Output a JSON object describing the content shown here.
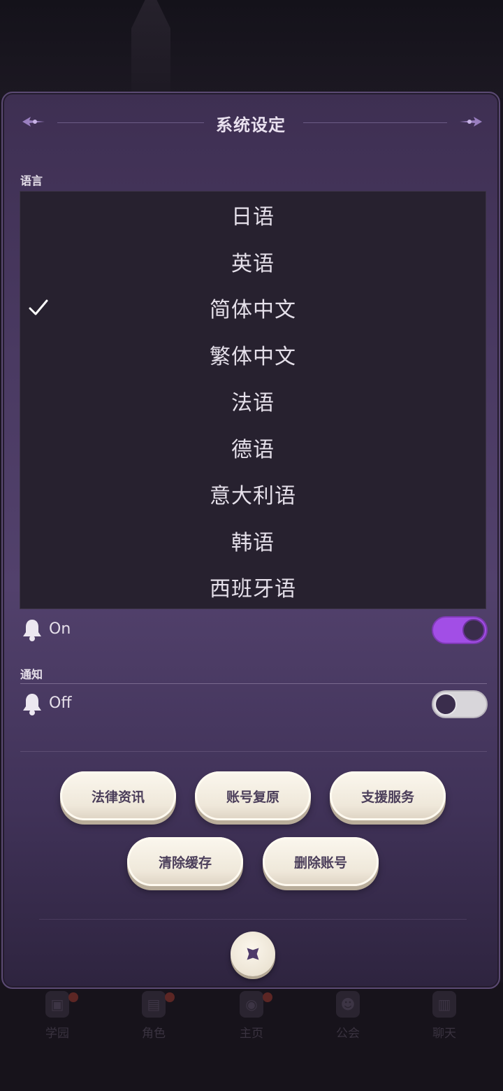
{
  "modal": {
    "title": "系统设定",
    "language_section_label": "语言",
    "notification_section_label": "通知"
  },
  "languages": [
    {
      "label": "日语",
      "selected": false
    },
    {
      "label": "英语",
      "selected": false
    },
    {
      "label": "简体中文",
      "selected": true
    },
    {
      "label": "繁体中文",
      "selected": false
    },
    {
      "label": "法语",
      "selected": false
    },
    {
      "label": "德语",
      "selected": false
    },
    {
      "label": "意大利语",
      "selected": false
    },
    {
      "label": "韩语",
      "selected": false
    },
    {
      "label": "西班牙语",
      "selected": false
    }
  ],
  "toggles": [
    {
      "label": "On",
      "state": "on"
    },
    {
      "label": "Off",
      "state": "off"
    }
  ],
  "buttons": {
    "legal_info": "法律资讯",
    "account_restore": "账号复原",
    "support_service": "支援服务",
    "clear_cache": "清除缓存",
    "delete_account": "删除账号"
  },
  "bottom_nav": [
    "学园",
    "角色",
    "主页",
    "公会",
    "聊天"
  ],
  "colors": {
    "accent": "#a24ee6",
    "modal_bg": "#4a3a62",
    "dropdown_bg": "#27212f",
    "button_face": "#f3ede1",
    "button_text": "#4b3e5a"
  }
}
